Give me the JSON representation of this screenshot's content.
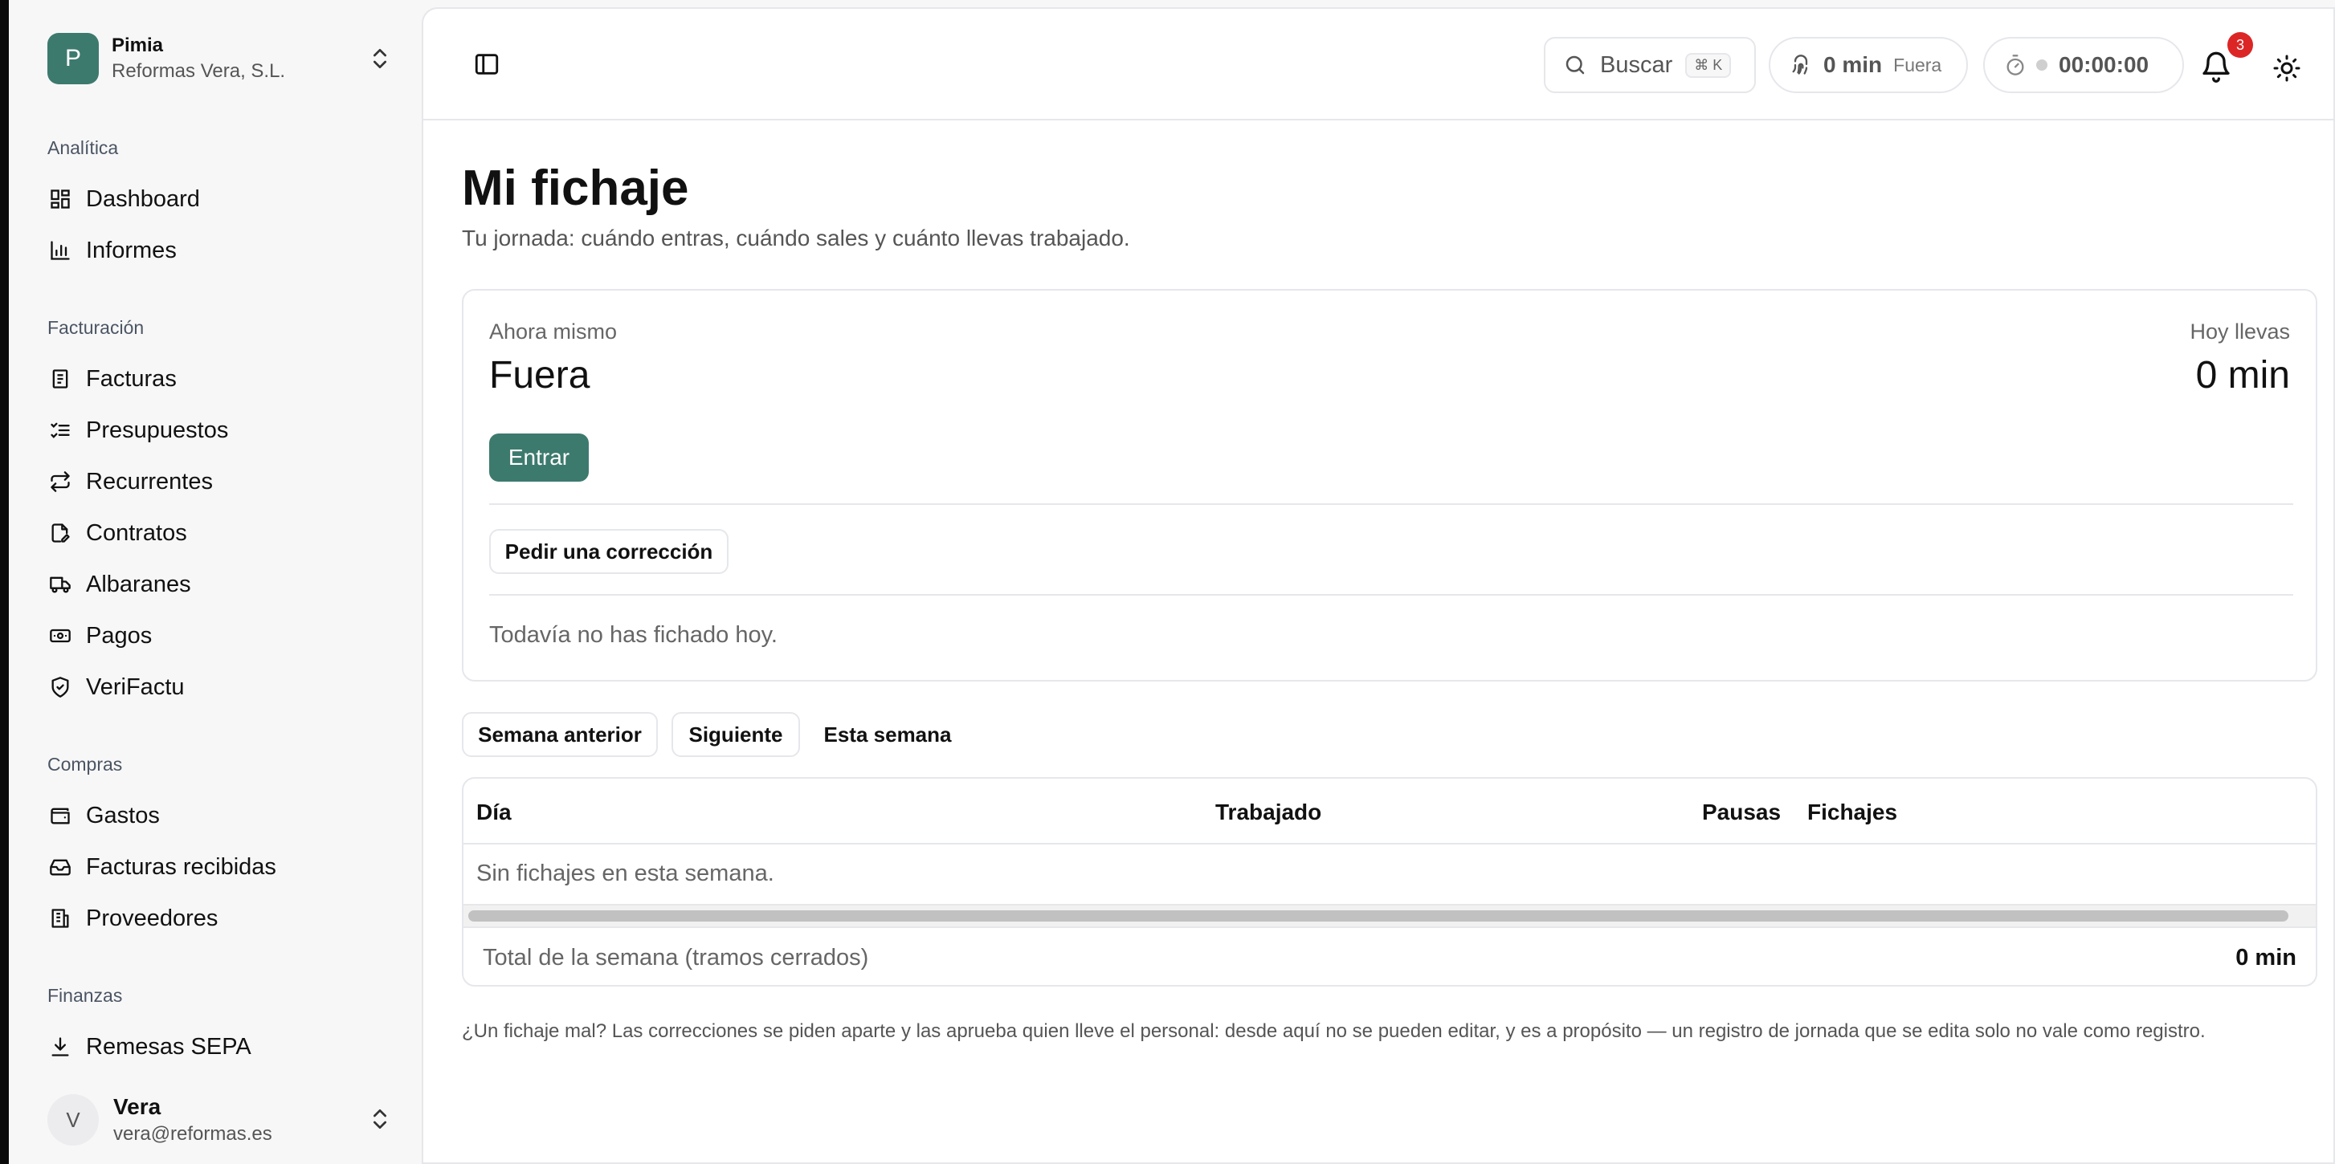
{
  "workspace": {
    "initial": "P",
    "name": "Pimia",
    "company": "Reformas Vera, S.L."
  },
  "sidebar": {
    "sections": [
      {
        "label": "Analítica",
        "items": [
          {
            "label": "Dashboard",
            "icon": "dashboard-icon"
          },
          {
            "label": "Informes",
            "icon": "bar-chart-icon"
          }
        ]
      },
      {
        "label": "Facturación",
        "items": [
          {
            "label": "Facturas",
            "icon": "receipt-icon"
          },
          {
            "label": "Presupuestos",
            "icon": "list-check-icon"
          },
          {
            "label": "Recurrentes",
            "icon": "repeat-icon"
          },
          {
            "label": "Contratos",
            "icon": "file-pen-icon"
          },
          {
            "label": "Albaranes",
            "icon": "truck-icon"
          },
          {
            "label": "Pagos",
            "icon": "banknote-icon"
          },
          {
            "label": "VeriFactu",
            "icon": "shield-check-icon"
          }
        ]
      },
      {
        "label": "Compras",
        "items": [
          {
            "label": "Gastos",
            "icon": "wallet-icon"
          },
          {
            "label": "Facturas recibidas",
            "icon": "inbox-icon"
          },
          {
            "label": "Proveedores",
            "icon": "building-icon"
          }
        ]
      },
      {
        "label": "Finanzas",
        "items": [
          {
            "label": "Remesas SEPA",
            "icon": "download-icon"
          }
        ]
      }
    ]
  },
  "user": {
    "initial": "V",
    "name": "Vera",
    "email": "vera@reformas.es"
  },
  "topbar": {
    "search_label": "Buscar",
    "search_shortcut": "⌘ K",
    "clock_minutes": "0 min",
    "clock_state": "Fuera",
    "timer": "00:00:00",
    "notifications": "3"
  },
  "page": {
    "title": "Mi fichaje",
    "subtitle": "Tu jornada: cuándo entras, cuándo sales y cuánto llevas trabajado."
  },
  "status": {
    "now_label": "Ahora mismo",
    "now_value": "Fuera",
    "today_label": "Hoy llevas",
    "today_value": "0 min",
    "enter_button": "Entrar",
    "correction_button": "Pedir una corrección",
    "empty_message": "Todavía no has fichado hoy."
  },
  "week": {
    "prev_button": "Semana anterior",
    "next_button": "Siguiente",
    "current_button": "Esta semana"
  },
  "table": {
    "columns": [
      "Día",
      "Trabajado",
      "Pausas",
      "Fichajes"
    ],
    "empty_message": "Sin fichajes en esta semana.",
    "total_label": "Total de la semana (tramos cerrados)",
    "total_value": "0 min"
  },
  "note": "¿Un fichaje mal? Las correcciones se piden aparte y las aprueba quien lleve el personal: desde aquí no se pueden editar, y es a propósito — un registro de jornada que se edita solo no vale como registro.",
  "colors": {
    "accent": "#3d7a6e",
    "badge": "#dc2626"
  }
}
